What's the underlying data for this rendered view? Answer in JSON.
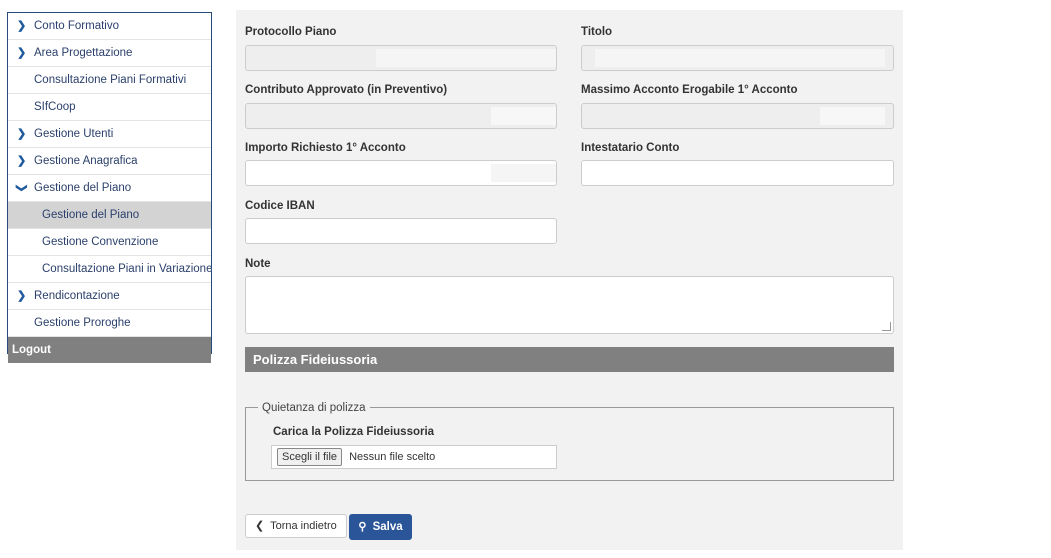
{
  "sidebar": {
    "items": [
      {
        "label": "Conto Formativo"
      },
      {
        "label": "Area Progettazione"
      },
      {
        "label": "Consultazione Piani Formativi"
      },
      {
        "label": "SIfCoop"
      },
      {
        "label": "Gestione Utenti"
      },
      {
        "label": "Gestione Anagrafica"
      },
      {
        "label": "Gestione del Piano"
      },
      {
        "label": "Gestione del Piano"
      },
      {
        "label": "Gestione Convenzione"
      },
      {
        "label": "Consultazione Piani in Variazione"
      },
      {
        "label": "Rendicontazione"
      },
      {
        "label": "Gestione Proroghe"
      }
    ],
    "logout_label": "Logout"
  },
  "form": {
    "protocollo_label": "Protocollo Piano",
    "protocollo_value": "",
    "titolo_label": "Titolo",
    "titolo_value": "",
    "contributo_label": "Contributo Approvato (in Preventivo)",
    "contributo_value": "",
    "massimo_label": "Massimo Acconto Erogabile 1° Acconto",
    "massimo_value": "",
    "importo_label": "Importo Richiesto 1° Acconto",
    "importo_value": "",
    "intestatario_label": "Intestatario Conto",
    "intestatario_value": "",
    "iban_label": "Codice IBAN",
    "iban_value": "",
    "note_label": "Note",
    "note_value": ""
  },
  "polizza": {
    "section_title": "Polizza Fideiussoria",
    "legend": "Quietanza di polizza",
    "upload_label": "Carica la Polizza Fideiussoria",
    "file_button": "Scegli il file",
    "no_file": "Nessun file scelto"
  },
  "actions": {
    "back_label": "Torna indietro",
    "save_label": "Salva"
  },
  "colors": {
    "sidebar_border": "#2a4a7a",
    "active_item": "#d3d3d3",
    "section_header": "#808080",
    "save_button": "#2b5599"
  }
}
